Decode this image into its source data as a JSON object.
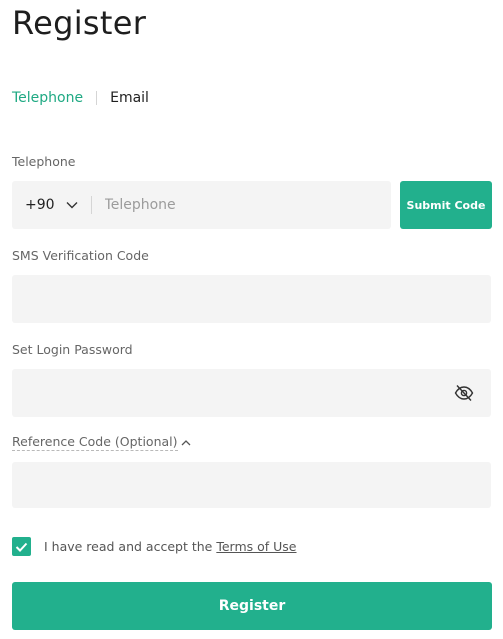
{
  "page": {
    "title": "Register"
  },
  "tabs": [
    {
      "label": "Telephone",
      "active": true
    },
    {
      "label": "Email",
      "active": false
    }
  ],
  "telephone": {
    "label": "Telephone",
    "country_code": "+90",
    "placeholder": "Telephone",
    "value": "",
    "submit_label": "Submit Code"
  },
  "sms": {
    "label": "SMS Verification Code",
    "value": ""
  },
  "password": {
    "label": "Set Login Password",
    "value": "",
    "visibility_icon": "eye-off-icon"
  },
  "reference": {
    "label": "Reference Code (Optional)",
    "expanded": true,
    "value": ""
  },
  "terms": {
    "checked": true,
    "text": "I have read and accept the",
    "link": "Terms of Use"
  },
  "register_button": {
    "label": "Register"
  },
  "colors": {
    "accent": "#22b08d",
    "tab_active": "#1fa983",
    "field_bg": "#f4f4f4"
  }
}
